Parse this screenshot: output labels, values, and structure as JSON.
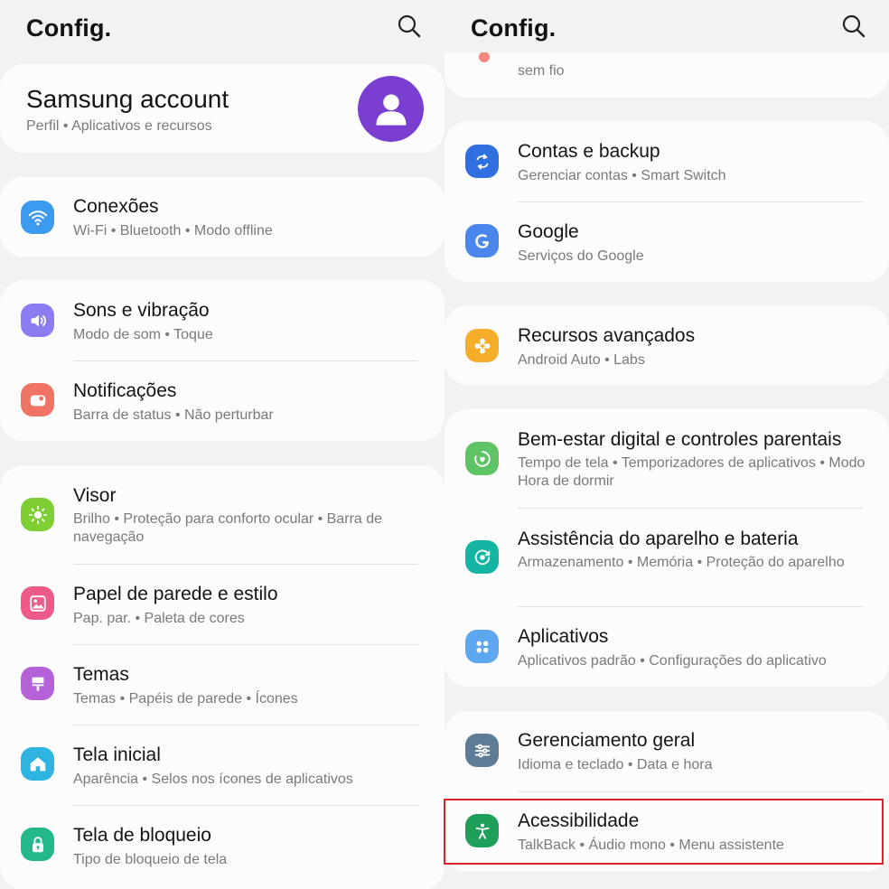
{
  "left": {
    "title": "Config.",
    "account": {
      "title": "Samsung account",
      "subtitle": "Perfil  •  Aplicativos e recursos"
    },
    "items": [
      {
        "title": "Conexões",
        "subtitle": "Wi-Fi  •  Bluetooth  •  Modo offline",
        "icon": "wifi-icon",
        "color": "#3d9bef"
      },
      {
        "title": "Sons e vibração",
        "subtitle": "Modo de som  •  Toque",
        "icon": "volume-icon",
        "color": "#8c7cf2"
      },
      {
        "title": "Notificações",
        "subtitle": "Barra de status  •  Não perturbar",
        "icon": "notification-icon",
        "color": "#f07466"
      },
      {
        "title": "Visor",
        "subtitle": "Brilho  •  Proteção para conforto ocular  •  Barra de navegação",
        "icon": "sun-icon",
        "color": "#7fcf34"
      },
      {
        "title": "Papel de parede e estilo",
        "subtitle": "Pap. par.  •  Paleta de cores",
        "icon": "image-icon",
        "color": "#ec5a88"
      },
      {
        "title": "Temas",
        "subtitle": "Temas  •  Papéis de parede  •  Ícones",
        "icon": "brush-icon",
        "color": "#b561d8"
      },
      {
        "title": "Tela inicial",
        "subtitle": "Aparência  •  Selos nos ícones de aplicativos",
        "icon": "home-icon",
        "color": "#2fb3e0"
      },
      {
        "title": "Tela de bloqueio",
        "subtitle": "Tipo de bloqueio de tela",
        "icon": "lock-icon",
        "color": "#22b88c"
      }
    ]
  },
  "right": {
    "title": "Config.",
    "partial_subtitle": "sem fio",
    "items": [
      {
        "title": "Contas e backup",
        "subtitle": "Gerenciar contas  •  Smart Switch",
        "icon": "sync-icon",
        "color": "#2f6fe0"
      },
      {
        "title": "Google",
        "subtitle": "Serviços do Google",
        "icon": "google-icon",
        "color": "#4a86ec"
      },
      {
        "title": "Recursos avançados",
        "subtitle": "Android Auto  •  Labs",
        "icon": "gear-plus-icon",
        "color": "#f5ad2a"
      },
      {
        "title": "Bem-estar digital e controles parentais",
        "subtitle": "Tempo de tela  •  Temporizadores de aplicativos  •  Modo Hora de dormir",
        "icon": "wellbeing-icon",
        "color": "#5ec466"
      },
      {
        "title": "Assistência do aparelho e bateria",
        "subtitle": "Armazenamento  •  Memória  •  Proteção do aparelho",
        "icon": "device-care-icon",
        "color": "#14b5a2"
      },
      {
        "title": "Aplicativos",
        "subtitle": "Aplicativos padrão  •  Configurações do aplicativo",
        "icon": "apps-icon",
        "color": "#5da6f0"
      },
      {
        "title": "Gerenciamento geral",
        "subtitle": "Idioma e teclado  •  Data e hora",
        "icon": "sliders-icon",
        "color": "#5e7c96"
      },
      {
        "title": "Acessibilidade",
        "subtitle": "TalkBack  •  Áudio mono  •  Menu assistente",
        "icon": "accessibility-icon",
        "color": "#1ea05a"
      }
    ]
  }
}
